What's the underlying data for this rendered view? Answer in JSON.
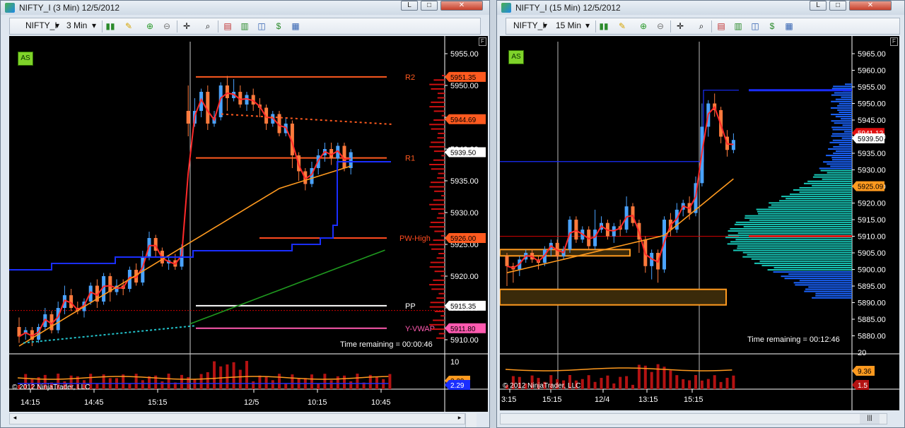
{
  "left": {
    "title": "NIFTY_I (3 Min)  12/5/2012",
    "instrument": "NIFTY_I",
    "interval": "3 Min",
    "as_label": "AS",
    "f_label": "F",
    "price_axis": [
      "5955.00",
      "5950.00",
      "5945.00",
      "5940.00",
      "5935.00",
      "5930.00",
      "5925.00",
      "5920.00",
      "5915.00",
      "5910.00"
    ],
    "levels": {
      "r2": "R2",
      "r1": "R1",
      "pw_high": "PW-High",
      "pp": "PP",
      "y_vwap": "Y-VWAP"
    },
    "price_tags": {
      "r2": "5951.35",
      "r1_a": "5939.50",
      "r1_b": "5938.60",
      "s1": "5944.69",
      "pw": "5926.00",
      "pp": "5915.35",
      "yvwap": "5911.80"
    },
    "time_remaining": "Time remaining = 00:00:46",
    "copyright": "© 2012 NinjaTrader, LLC",
    "vol_axis": [
      "10"
    ],
    "vol_tags": {
      "a": "2.29",
      "b": "2.29"
    },
    "time_axis": [
      "14:15",
      "14:45",
      "15:15",
      "12/5",
      "10:15",
      "10:45"
    ]
  },
  "right": {
    "title": "NIFTY_I (15 Min)  12/5/2012",
    "instrument": "NIFTY_I",
    "interval": "15 Min",
    "as_label": "AS",
    "f_label": "F",
    "price_axis": [
      "5965.00",
      "5960.00",
      "5955.00",
      "5950.00",
      "5945.00",
      "5940.00",
      "5935.00",
      "5930.00",
      "5925.00",
      "5920.00",
      "5915.00",
      "5910.00",
      "5905.00",
      "5900.00",
      "5895.00",
      "5890.00",
      "5885.00",
      "5880.00"
    ],
    "price_tags": {
      "a": "5941.12",
      "b": "5939.50",
      "c": "5925.09"
    },
    "time_remaining": "Time remaining = 00:12:46",
    "copyright": "© 2012 NinjaTrader, LLC",
    "vol_axis": [
      "20"
    ],
    "vol_tags": {
      "a": "9.36",
      "b": "1.5"
    },
    "time_axis": [
      "3:15",
      "15:15",
      "12/4",
      "13:15",
      "15:15"
    ]
  },
  "window_buttons": {
    "min": "L",
    "restore": "□",
    "close": "✕"
  },
  "toolbar_icons": [
    "bar-chart-icon",
    "pencil-icon",
    "zoom-in-icon",
    "zoom-out-icon",
    "crosshair-icon",
    "magnifier-icon",
    "indicators-icon",
    "strategies-icon",
    "chart-style-icon",
    "dollar-icon",
    "properties-icon"
  ],
  "colors": {
    "bg": "#000000",
    "price_line": "#ff2a2a",
    "ma_orange": "#ff9a1f",
    "vwap_blue": "#1a2eff",
    "green_line": "#1f9a1f",
    "cyan_dots": "#22c0c8",
    "up": "#4aa3ff",
    "down": "#ff7a3c"
  }
}
